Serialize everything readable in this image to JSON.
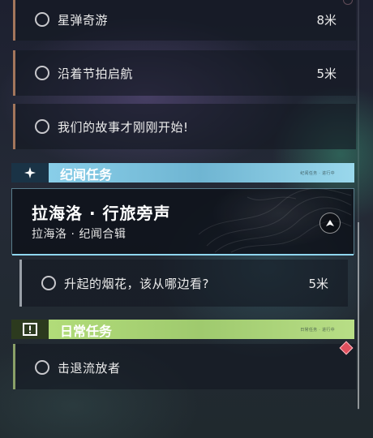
{
  "main_tasks": [
    {
      "name": "星弹奇游",
      "distance": "8米"
    },
    {
      "name": "沿着节拍启航",
      "distance": "5米"
    },
    {
      "name": "我们的故事才刚刚开始!",
      "distance": ""
    }
  ],
  "legend_section": {
    "title": "纪闻任务",
    "tiny_text": "纪闻任务 · 进行中",
    "accent_color": "#8fd4ee"
  },
  "legend_quest": {
    "title": "拉海洛 · 行旅旁声",
    "subtitle": "拉海洛 · 纪闻合辑"
  },
  "legend_task": {
    "name": "升起的烟花，该从哪边看?",
    "distance": "5米"
  },
  "daily_section": {
    "title": "日常任务",
    "tiny_text": "日常任务 · 进行中",
    "accent_color": "#b6e07c"
  },
  "daily_task": {
    "name": "击退流放者",
    "distance": ""
  },
  "colors": {
    "main_stripe": "#a3765c",
    "legend_stripe": "#9aa0a8",
    "daily_stripe": "#8aa068",
    "tracker_diamond": "#e0505e"
  }
}
